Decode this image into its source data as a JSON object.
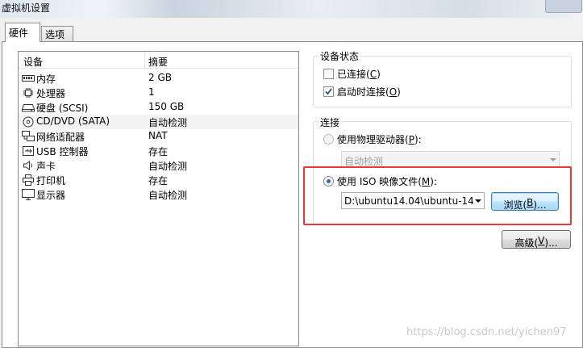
{
  "window": {
    "title": "虚拟机设置"
  },
  "tabs": [
    {
      "label": "硬件",
      "active": true
    },
    {
      "label": "选项",
      "active": false
    }
  ],
  "device_list": {
    "columns": {
      "device": "设备",
      "summary": "摘要"
    },
    "rows": [
      {
        "icon": "memory-icon",
        "name": "内存",
        "summary": "2 GB"
      },
      {
        "icon": "processor-icon",
        "name": "处理器",
        "summary": "1"
      },
      {
        "icon": "hard-disk-icon",
        "name": "硬盘 (SCSI)",
        "summary": "150 GB"
      },
      {
        "icon": "cd-dvd-icon",
        "name": "CD/DVD (SATA)",
        "summary": "自动检测",
        "selected": true
      },
      {
        "icon": "network-adapter-icon",
        "name": "网络适配器",
        "summary": "NAT"
      },
      {
        "icon": "usb-icon",
        "name": "USB 控制器",
        "summary": "存在"
      },
      {
        "icon": "sound-card-icon",
        "name": "声卡",
        "summary": "自动检测"
      },
      {
        "icon": "printer-icon",
        "name": "打印机",
        "summary": "存在"
      },
      {
        "icon": "display-icon",
        "name": "显示器",
        "summary": "自动检测"
      }
    ]
  },
  "device_status": {
    "title": "设备状态",
    "connected": {
      "label_prefix": "已连接(",
      "accesskey": "C",
      "label_suffix": ")",
      "checked": false
    },
    "connect_at_power_on": {
      "label_prefix": "启动时连接(",
      "accesskey": "O",
      "label_suffix": ")",
      "checked": true
    }
  },
  "connection": {
    "title": "连接",
    "physical_drive": {
      "label_prefix": "使用物理驱动器(",
      "accesskey": "P",
      "label_suffix": "):",
      "selected": false,
      "value": "自动检测"
    },
    "iso_image": {
      "label_prefix": "使用 ISO 映像文件(",
      "accesskey": "M",
      "label_suffix": "):",
      "selected": true,
      "value": "D:\\ubuntu14.04\\ubuntu-14"
    },
    "browse_button": {
      "label_prefix": "浏览(",
      "accesskey": "B",
      "label_suffix": ")..."
    },
    "advanced_button": {
      "label_prefix": "高级(",
      "accesskey": "V",
      "label_suffix": ")..."
    }
  },
  "watermark": "https://blog.csdn.net/yichen97",
  "colors": {
    "highlight_box": "#e8393a",
    "radio_dot": "#3a66a7",
    "check_mark": "#2b4f8a"
  }
}
